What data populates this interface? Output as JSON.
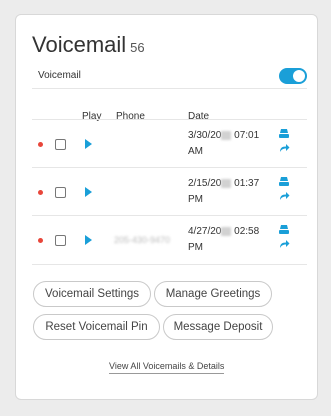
{
  "widget": {
    "title": "Voicemail",
    "count": "56",
    "toggle_label": "Voicemail",
    "toggle_on": true
  },
  "table": {
    "headers": {
      "play": "Play",
      "phone": "Phone",
      "date": "Date"
    },
    "rows": [
      {
        "unread": true,
        "phone": "",
        "date_line1": "3/30/20",
        "time": "07:01",
        "ampm": "AM"
      },
      {
        "unread": true,
        "phone": "",
        "date_line1": "2/15/20",
        "time": "01:37",
        "ampm": "PM"
      },
      {
        "unread": true,
        "phone": "205-430-9470",
        "date_line1": "4/27/20",
        "time": "02:58",
        "ampm": "PM"
      }
    ]
  },
  "buttons": {
    "settings": "Voicemail Settings",
    "greetings": "Manage Greetings",
    "reset_pin": "Reset Voicemail Pin",
    "deposit": "Message Deposit"
  },
  "link": {
    "view_all": "View All Voicemails & Details"
  },
  "colors": {
    "accent": "#1a9fd8",
    "unread_dot": "#e8463a"
  },
  "icons": {
    "play": "play-icon",
    "download": "download-icon",
    "forward": "forward-icon"
  }
}
